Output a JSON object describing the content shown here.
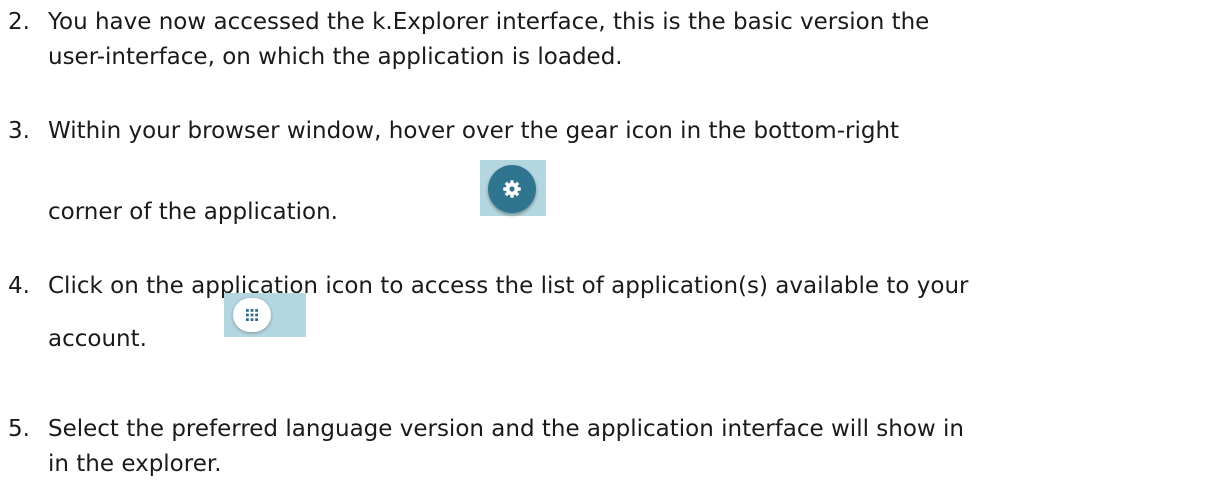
{
  "steps": [
    {
      "number": "2.",
      "lines": [
        "You have now accessed the k.Explorer interface, this is the basic version the",
        "user-interface, on which the application is loaded."
      ]
    },
    {
      "number": "3.",
      "lines": [
        "Within your browser window, hover over the gear icon in the bottom-right",
        "corner of the application."
      ],
      "image_icon": "gear-icon"
    },
    {
      "number": "4.",
      "lines": [
        "Click on the application icon to access the list of application(s) available to your",
        "account."
      ],
      "image_icon": "apps-grid-icon"
    },
    {
      "number": "5.",
      "lines": [
        "Select the preferred language version and the application interface will show in",
        "in the explorer."
      ]
    }
  ],
  "colors": {
    "text": "#1a1a1a",
    "thumbnail_background": "#b3d6e0",
    "gear_button": "#2f7590",
    "apps_button": "#ffffff",
    "apps_dots": "#2f6f8a"
  }
}
